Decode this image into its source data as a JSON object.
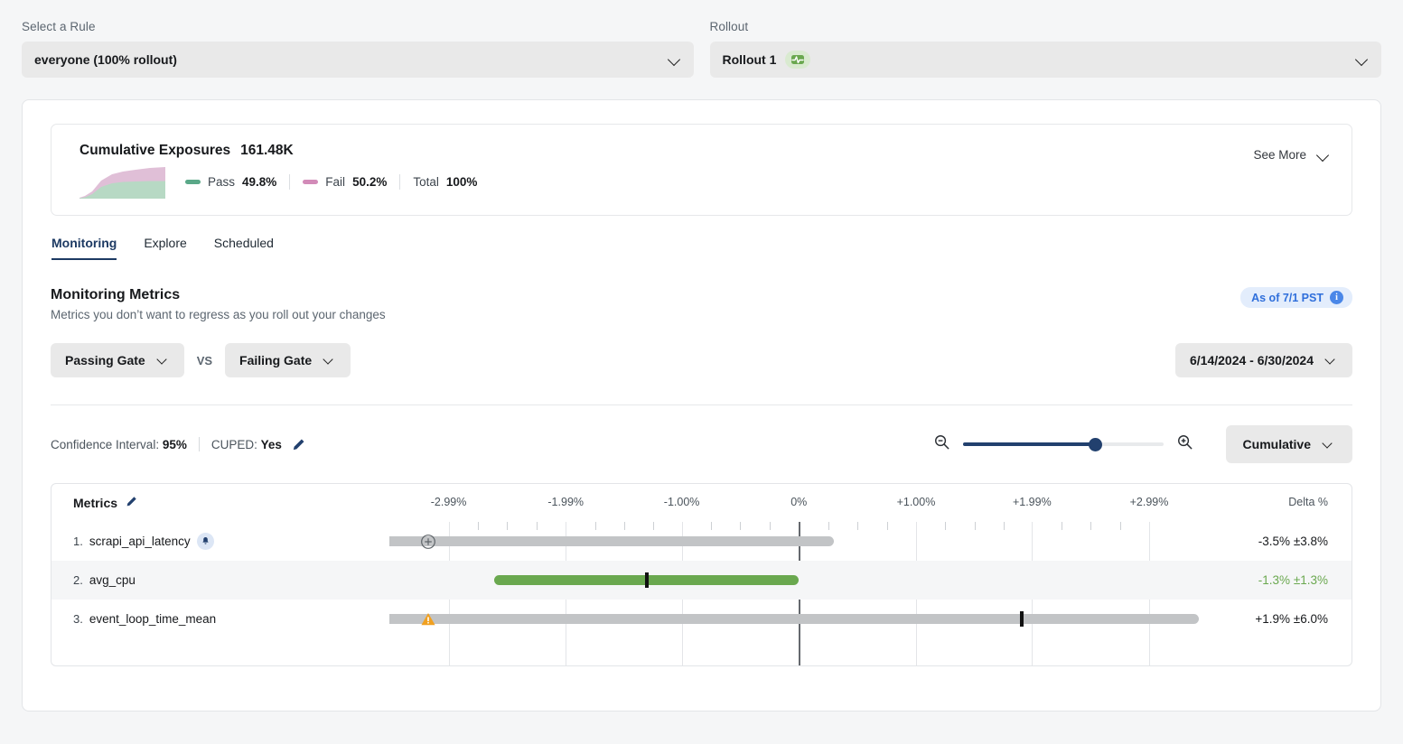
{
  "top": {
    "rule": {
      "label": "Select a Rule",
      "value": "everyone (100% rollout)",
      "chevron_icon": "chevron-down-icon"
    },
    "rollout": {
      "label": "Rollout",
      "value": "Rollout 1",
      "badge_icon": "pulse-icon",
      "badge_color": "#6aa84f",
      "chevron_icon": "chevron-down-icon"
    }
  },
  "exposures": {
    "title": "Cumulative Exposures",
    "value": "161.48K",
    "see_more": "See More",
    "legend": [
      {
        "label": "Pass",
        "value": "49.8%",
        "color": "#5aa888"
      },
      {
        "label": "Fail",
        "value": "50.2%",
        "color": "#d28bb8"
      },
      {
        "label": "Total",
        "value": "100%",
        "color": ""
      }
    ],
    "sparkline": {
      "pass": [
        2,
        3,
        6,
        14,
        19,
        21,
        22,
        22,
        22
      ],
      "fail": [
        2,
        4,
        8,
        16,
        20,
        23,
        25,
        26,
        26
      ],
      "pass_color": "#b7d9c4",
      "fail_color": "#e0bfd7"
    }
  },
  "tabs": [
    {
      "label": "Monitoring",
      "active": true
    },
    {
      "label": "Explore",
      "active": false
    },
    {
      "label": "Scheduled",
      "active": false
    }
  ],
  "section": {
    "title": "Monitoring Metrics",
    "subtitle": "Metrics you don’t want to regress as you roll out your changes",
    "as_of": "As of 7/1 PST",
    "info_icon": "info-icon"
  },
  "gates": {
    "passing": "Passing Gate",
    "vs": "VS",
    "failing": "Failing Gate",
    "date_range": "6/14/2024 - 6/30/2024"
  },
  "controls": {
    "confidence_label": "Confidence Interval:",
    "confidence_value": "95%",
    "cuped_label": "CUPED:",
    "cuped_value": "Yes",
    "edit_icon": "pencil-icon",
    "zoom_out_icon": "zoom-out-icon",
    "zoom_in_icon": "zoom-in-icon",
    "zoom_slider_percent": 66,
    "view_mode": "Cumulative"
  },
  "chart_data": {
    "type": "bar",
    "title": "Monitoring Metrics",
    "xlabel": "Delta %",
    "axis_ticks": [
      "-2.99%",
      "-1.99%",
      "-1.00%",
      "0%",
      "+1.00%",
      "+1.99%",
      "+2.99%"
    ],
    "axis_values": [
      -2.99,
      -1.99,
      -1.0,
      0,
      1.0,
      1.99,
      2.99
    ],
    "xlim": [
      -3.48,
      2.99
    ],
    "zero_line": 0,
    "grid": true,
    "delta_header": "Delta %",
    "metrics_header": "Metrics",
    "metrics_edit_icon": "pencil-icon",
    "series": [
      {
        "index": "1.",
        "name": "scrapi_api_latency",
        "delta": -3.5,
        "ci": 3.8,
        "delta_label": "-3.5% ±3.8%",
        "ci_low": -7.3,
        "ci_high": 0.3,
        "bar_color": "#c2c4c6",
        "significant": false,
        "icons": [
          "bell-icon",
          "plus-circle-icon"
        ],
        "clipped_left": true
      },
      {
        "index": "2.",
        "name": "avg_cpu",
        "delta": -1.3,
        "ci": 1.3,
        "delta_label": "-1.3% ±1.3%",
        "ci_low": -2.6,
        "ci_high": 0.0,
        "bar_color": "#6aa84f",
        "significant": true,
        "icons": [],
        "clipped_left": false
      },
      {
        "index": "3.",
        "name": "event_loop_time_mean",
        "delta": 1.9,
        "ci": 6.0,
        "delta_label": "+1.9% ±6.0%",
        "ci_low": -4.1,
        "ci_high": 7.9,
        "bar_color": "#c2c4c6",
        "significant": false,
        "icons": [
          "warning-icon"
        ],
        "clipped_left": true
      }
    ]
  }
}
